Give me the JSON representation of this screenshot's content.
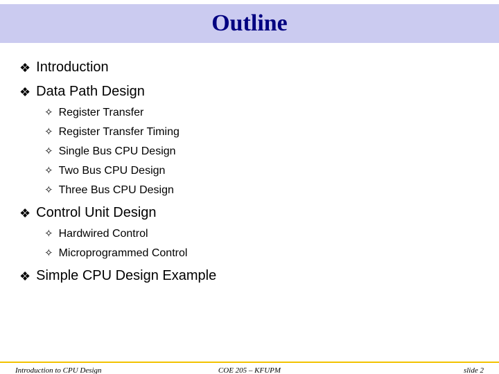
{
  "title": "Outline",
  "bullets": [
    {
      "label": "Introduction",
      "subs": []
    },
    {
      "label": "Data Path Design",
      "subs": [
        "Register Transfer",
        "Register Transfer Timing",
        "Single Bus CPU Design",
        "Two Bus CPU Design",
        "Three Bus CPU Design"
      ]
    },
    {
      "label": "Control Unit Design",
      "subs": [
        "Hardwired Control",
        "Microprogrammed Control"
      ]
    },
    {
      "label": "Simple CPU Design Example",
      "subs": []
    }
  ],
  "footer": {
    "left": "Introduction to CPU Design",
    "center": "COE 205 – KFUPM",
    "right": "slide 2"
  },
  "glyphs": {
    "main": "❖",
    "sub": "✧"
  }
}
